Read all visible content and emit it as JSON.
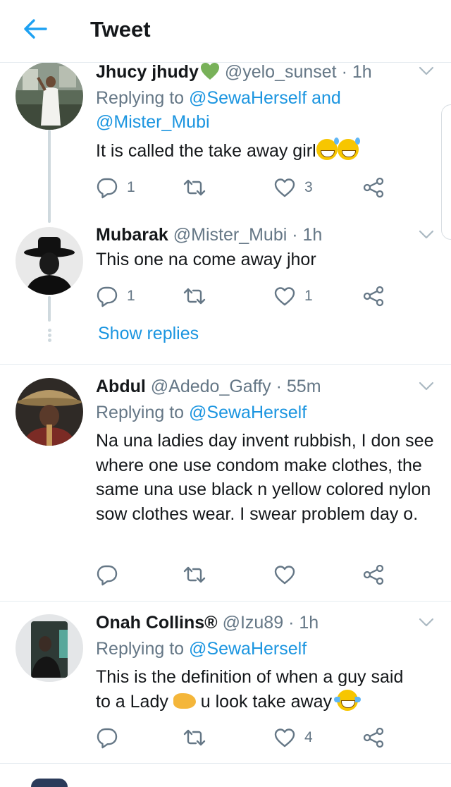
{
  "header": {
    "title": "Tweet"
  },
  "tweets": [
    {
      "name": "Jhucy jhudy",
      "handle": "@yelo_sunset",
      "time": "· 1h",
      "replying_prefix": "Replying to ",
      "replying_mention1": "@SewaHerself",
      "replying_and": " and",
      "replying_mention2": "@Mister_Mubi",
      "text": "It is called the take away girl",
      "reply_count": "1",
      "retweet_count": "",
      "like_count": "3"
    },
    {
      "name": "Mubarak",
      "handle": "@Mister_Mubi",
      "time": "· 1h",
      "text": "This one na come away jhor",
      "reply_count": "1",
      "retweet_count": "",
      "like_count": "1"
    },
    {
      "name": "Abdul",
      "handle": "@Adedo_Gaffy",
      "time": "· 55m",
      "replying_prefix": "Replying to ",
      "replying_mention1": "@SewaHerself",
      "text": "Na una ladies day invent rubbish, I don see where one use condom make clothes, the same una use black n yellow colored nylon sow clothes wear. I swear problem day o.",
      "reply_count": "",
      "retweet_count": "",
      "like_count": ""
    },
    {
      "name": "Onah Collins®",
      "handle": "@Izu89",
      "time": "· 1h",
      "replying_prefix": "Replying to ",
      "replying_mention1": "@SewaHerself",
      "text_line1": "This is the definition of when a guy said",
      "text_part1": "to a Lady ",
      "text_part2": " u look take away ",
      "reply_count": "",
      "retweet_count": "",
      "like_count": "4"
    }
  ],
  "show_replies": "Show replies",
  "colors": {
    "link": "#1b95e0",
    "secondary": "#657786",
    "divider": "#e6ecf0",
    "green_heart": "#78b159"
  },
  "icons": [
    "back-arrow-icon",
    "reply-icon",
    "retweet-icon",
    "like-icon",
    "share-icon",
    "chevron-down-icon",
    "green-heart-emoji",
    "sweat-smile-emoji",
    "tears-of-joy-emoji",
    "pointing-hand-emoji"
  ]
}
